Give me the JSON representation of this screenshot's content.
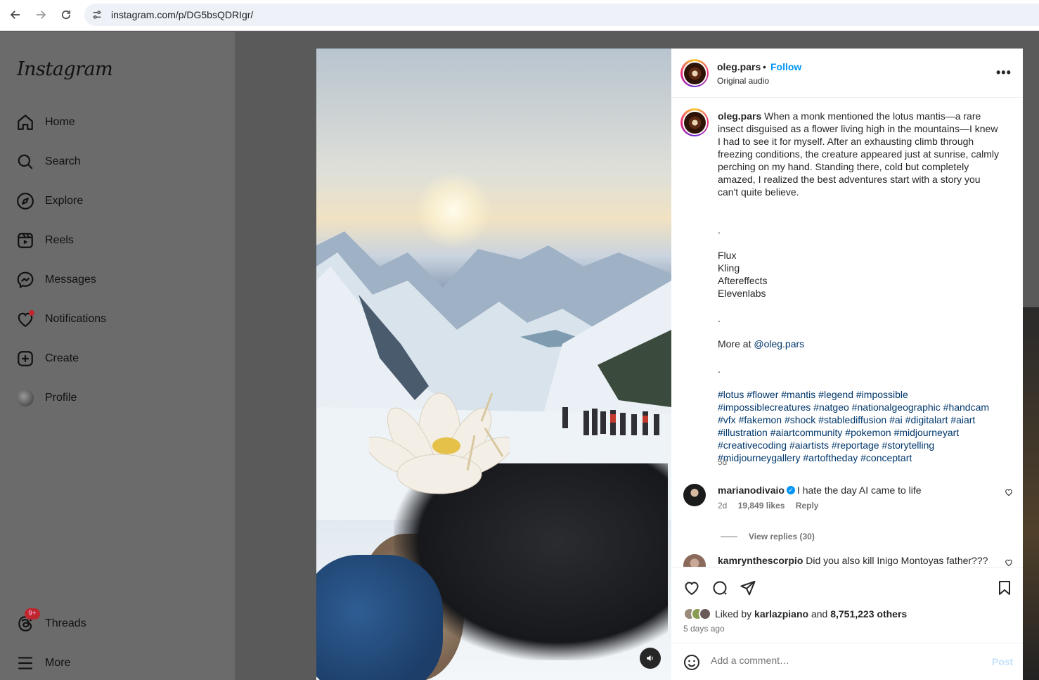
{
  "browser": {
    "url": "instagram.com/p/DG5bsQDRIgr/"
  },
  "sidebar": {
    "logo": "Instagram",
    "items": [
      {
        "label": "Home"
      },
      {
        "label": "Search"
      },
      {
        "label": "Explore"
      },
      {
        "label": "Reels"
      },
      {
        "label": "Messages"
      },
      {
        "label": "Notifications"
      },
      {
        "label": "Create"
      },
      {
        "label": "Profile"
      }
    ],
    "threads": {
      "label": "Threads",
      "badge": "9+"
    },
    "more": {
      "label": "More"
    }
  },
  "post": {
    "username": "oleg.pars",
    "separator": "•",
    "follow_label": "Follow",
    "audio": "Original audio",
    "more_label": "•••",
    "caption": {
      "username": "oleg.pars",
      "text": "When a monk mentioned the lotus mantis—a rare insect disguised as a flower living high in the mountains—I knew I had to see it for myself. After an exhausting climb through freezing conditions, the creature appeared just at sunrise, calmly perching on my hand. Standing there, cold but completely amazed, I realized the best adventures start with a story you can't quite believe.",
      "dot1": ".",
      "tool1": "Flux",
      "tool2": "Kling",
      "tool3": "Aftereffects",
      "tool4": "Elevenlabs",
      "dot2": ".",
      "more_prefix": "More at ",
      "more_link": "@oleg.pars",
      "dot3": ".",
      "hashtags": "#lotus #flower #mantis #legend #impossible #impossiblecreatures #natgeo #nationalgeographic #handcam #vfx #fakemon #shock #stablediffusion #ai #digitalart #aiart #illustration #aiartcommunity #pokemon #midjourneyart #creativecoding #aiartists #reportage #storytelling #midjourneygallery #artoftheday #conceptart",
      "time": "5d"
    },
    "comments": [
      {
        "username": "marianodivaio",
        "text": "I hate the day AI came to life",
        "time": "2d",
        "likes": "19,849 likes",
        "reply_label": "Reply",
        "view_replies": "View replies (30)"
      },
      {
        "username": "kamrynthescorpio",
        "text": "Did you also kill Inigo Montoyas father???"
      }
    ],
    "liked_by_prefix": "Liked by ",
    "liked_by_user": "karlazpiano",
    "liked_by_and": " and ",
    "liked_by_count": "8,751,223 others",
    "posted_ago": "5 days ago",
    "comment_placeholder": "Add a comment…",
    "post_label": "Post"
  },
  "colors": {
    "accent": "#0095f6",
    "link": "#00376b",
    "badge": "#c0262d"
  }
}
